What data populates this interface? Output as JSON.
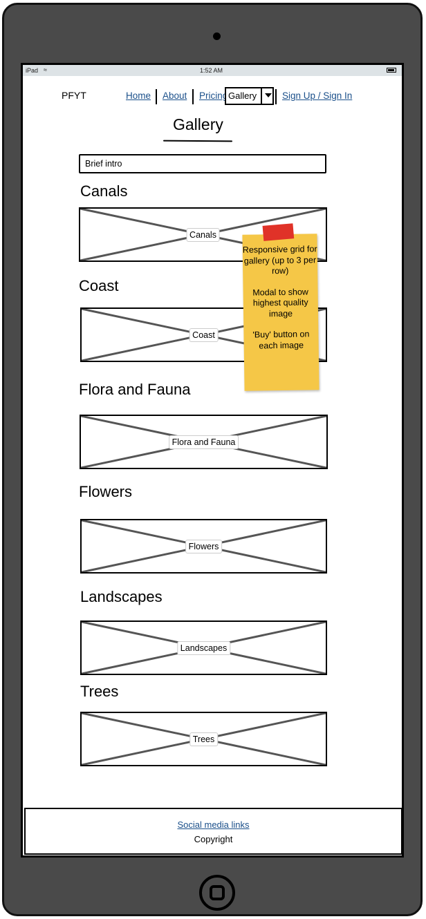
{
  "status": {
    "carrier": "iPad",
    "time": "1:52 AM"
  },
  "header": {
    "brand": "PFYT",
    "nav": {
      "home": "Home",
      "about": "About",
      "pricing": "Pricing",
      "gallery": "Gallery",
      "signup": "Sign Up / Sign In"
    }
  },
  "page": {
    "title": "Gallery",
    "intro": "Brief intro"
  },
  "sections": [
    {
      "heading": "Canals",
      "image_label": "Canals"
    },
    {
      "heading": "Coast",
      "image_label": "Coast"
    },
    {
      "heading": "Flora and Fauna",
      "image_label": "Flora and Fauna"
    },
    {
      "heading": "Flowers",
      "image_label": "Flowers"
    },
    {
      "heading": "Landscapes",
      "image_label": "Landscapes"
    },
    {
      "heading": "Trees",
      "image_label": "Trees"
    }
  ],
  "note": {
    "p1": "Responsive grid for gallery (up to 3 per row)",
    "p2": "Modal to show highest quality image",
    "p3": "'Buy' button on each image"
  },
  "footer": {
    "social": "Social media links",
    "copyright": "Copyright"
  },
  "colors": {
    "device": "#4a4a4a",
    "link": "#1a4f8a",
    "note": "#f5c747",
    "tape": "#e03228"
  }
}
